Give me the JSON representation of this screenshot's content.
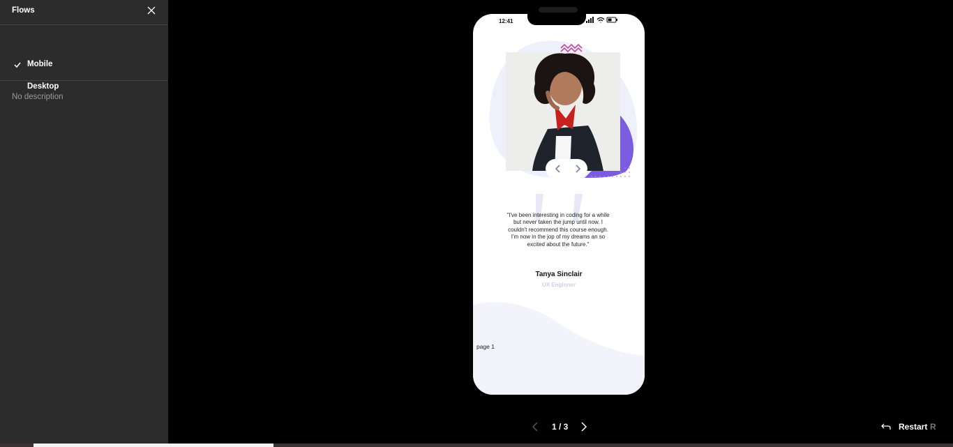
{
  "sidebar": {
    "title": "Flows",
    "flows": [
      {
        "label": "Mobile",
        "selected": true
      },
      {
        "label": "Desktop",
        "selected": false
      }
    ],
    "description": "No description"
  },
  "phone": {
    "time": "12:41",
    "testimonial": {
      "quote": "\"I've been interesting in coding for a while but never taken the jump until now. I couldn't recommend this course enough. I'm now in the jop of my dreams an so  excited about the future.\"",
      "name": "Tanya Sinclair",
      "role": "UX Enginner"
    },
    "page_label": "page 1"
  },
  "pager": {
    "count": "1 / 3"
  },
  "restart": {
    "label": "Restart",
    "shortcut": "R"
  },
  "colors": {
    "accent_purple": "#7b5ce0",
    "soft_lavender": "#eef0fb",
    "zigzag_pink": "#c04a9a"
  },
  "icons": [
    "close-icon",
    "check-icon",
    "chevron-left-icon",
    "chevron-right-icon",
    "restart-icon",
    "signal-icon",
    "wifi-icon",
    "battery-icon"
  ]
}
